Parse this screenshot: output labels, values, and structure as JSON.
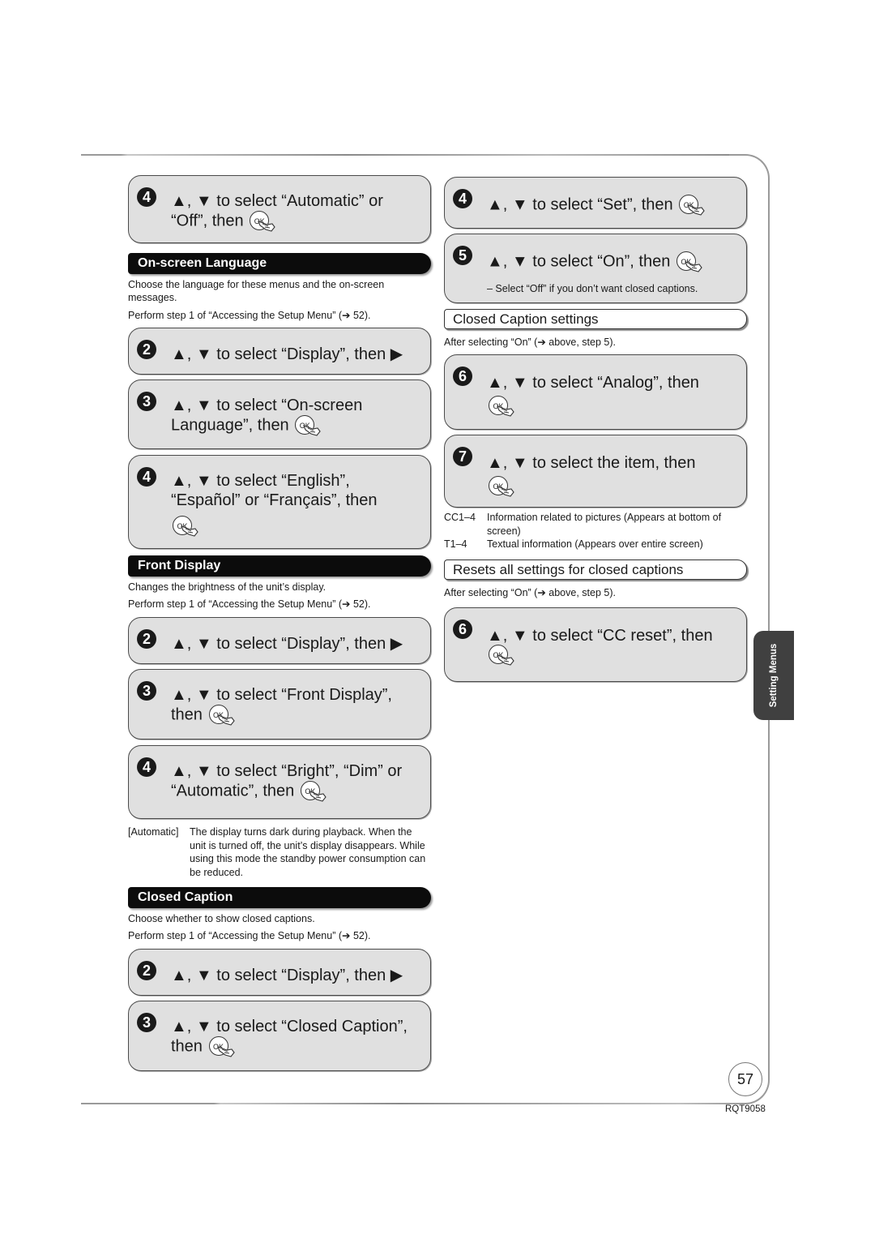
{
  "page": {
    "number": "57",
    "doc_id": "RQT9058",
    "side_tab": "Setting Menus"
  },
  "icons": {
    "up": "▲",
    "down": "▼",
    "right": "▶",
    "ok_label": "OK",
    "ref_arrow": "→"
  },
  "left_column": {
    "top_step": {
      "num": "4",
      "text_a": "▲, ▼ to select “Automatic” or",
      "text_b": "“Off”, then"
    },
    "on_screen_language": {
      "title": "On-screen Language",
      "desc": "Choose the language for these menus and the on-screen messages.",
      "perform": "Perform step 1 of “Accessing the Setup Menu” (➔ 52).",
      "steps": [
        {
          "num": "2",
          "text": "▲, ▼ to select “Display”, then ▶"
        },
        {
          "num": "3",
          "text_a": "▲, ▼ to select “On-screen",
          "text_b": "Language”, then"
        },
        {
          "num": "4",
          "text_a": "▲, ▼ to select “English”,",
          "text_b": "“Español” or “Français”, then"
        }
      ]
    },
    "front_display": {
      "title": "Front Display",
      "desc": "Changes the brightness of the unit’s display.",
      "perform": "Perform step 1 of “Accessing the Setup Menu” (➔ 52).",
      "steps": [
        {
          "num": "2",
          "text": "▲, ▼ to select “Display”, then ▶"
        },
        {
          "num": "3",
          "text_a": "▲, ▼ to select “Front Display”,",
          "text_b": "then"
        },
        {
          "num": "4",
          "text_a": "▲, ▼ to select “Bright”, “Dim” or",
          "text_b": "“Automatic”, then"
        }
      ],
      "note_term": "[Automatic]",
      "note_desc": "The display turns dark during playback. When the unit is turned off, the unit’s display disappears. While using this mode the standby power consumption can be reduced."
    },
    "closed_caption": {
      "title": "Closed Caption",
      "desc": "Choose whether to show closed captions.",
      "perform": "Perform step 1 of “Accessing the Setup Menu” (➔ 52).",
      "steps": [
        {
          "num": "2",
          "text": "▲, ▼ to select “Display”, then ▶"
        },
        {
          "num": "3",
          "text_a": "▲, ▼ to select “Closed Caption”,",
          "text_b": "then"
        }
      ]
    }
  },
  "right_column": {
    "steps_top": [
      {
        "num": "4",
        "text": "▲, ▼ to select “Set”, then"
      },
      {
        "num": "5",
        "text": "▲, ▼ to select “On”, then",
        "note": "– Select “Off” if you don’t want closed captions."
      }
    ],
    "cc_settings": {
      "title": "Closed Caption settings",
      "after": "After selecting “On” (➔ above, step 5).",
      "steps": [
        {
          "num": "6",
          "text": "▲, ▼ to select “Analog”, then"
        },
        {
          "num": "7",
          "text": "▲, ▼ to select the item, then"
        }
      ],
      "defs": [
        {
          "term": "CC1–4",
          "desc": "Information related to pictures (Appears at bottom of screen)"
        },
        {
          "term": "T1–4",
          "desc": "Textual information (Appears over entire screen)"
        }
      ]
    },
    "cc_reset": {
      "title": "Resets all settings for closed captions",
      "after": "After selecting “On” (➔ above, step 5).",
      "steps": [
        {
          "num": "6",
          "text": "▲, ▼ to select “CC reset”, then"
        }
      ]
    }
  }
}
